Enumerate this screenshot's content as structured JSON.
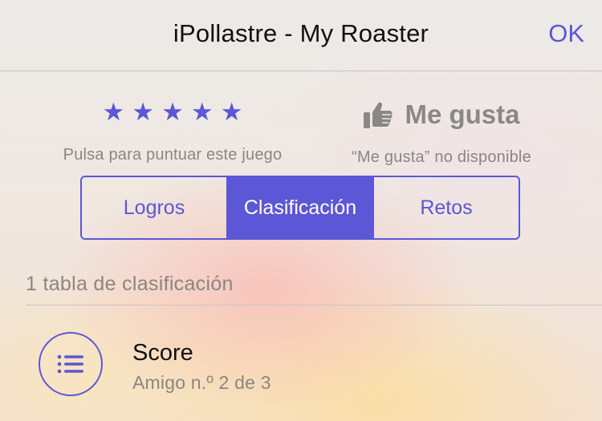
{
  "nav": {
    "title": "iPollastre - My Roaster",
    "ok_label": "OK"
  },
  "rating": {
    "stars": [
      "★",
      "★",
      "★",
      "★",
      "★"
    ],
    "caption": "Pulsa para puntuar este juego"
  },
  "like": {
    "icon": "thumbs-up-icon",
    "label": "Me gusta",
    "caption": "“Me gusta” no disponible"
  },
  "tabs": [
    {
      "label": "Logros",
      "selected": false
    },
    {
      "label": "Clasificación",
      "selected": true
    },
    {
      "label": "Retos",
      "selected": false
    }
  ],
  "leaderboards": {
    "header": "1 tabla de clasificación",
    "items": [
      {
        "icon": "list-icon",
        "title": "Score",
        "subtitle": "Amigo n.º 2 de 3"
      }
    ]
  },
  "colors": {
    "accent": "#5b57d6",
    "secondary_text": "#8a8683",
    "disabled": "#8a8887"
  }
}
